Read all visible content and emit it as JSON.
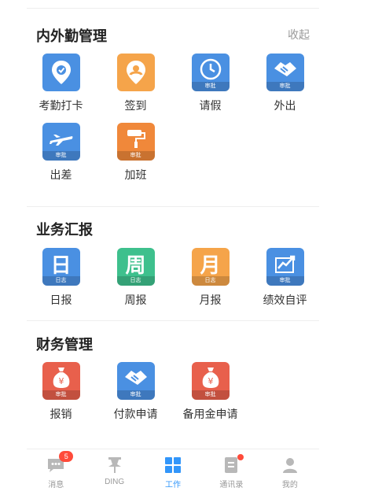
{
  "colors": {
    "blue": "#4a90e2",
    "orange": "#f5a44a",
    "green": "#3ec08d",
    "red": "#e8604c",
    "active_tab": "#3296fa"
  },
  "attendance": {
    "title": "内外勤管理",
    "collapse_label": "收起",
    "items": [
      {
        "label": "考勤打卡",
        "icon": "location-pin-icon"
      },
      {
        "label": "签到",
        "icon": "checkin-pin-icon"
      },
      {
        "label": "请假",
        "icon": "clock-icon",
        "band": "审批"
      },
      {
        "label": "外出",
        "icon": "handshake-icon",
        "band": "审批"
      },
      {
        "label": "出差",
        "icon": "airplane-icon",
        "band": "审批"
      },
      {
        "label": "加班",
        "icon": "paint-roller-icon",
        "band": "审批"
      }
    ]
  },
  "reports": {
    "title": "业务汇报",
    "items": [
      {
        "label": "日报",
        "char": "日",
        "band": "日志"
      },
      {
        "label": "周报",
        "char": "周",
        "band": "日志"
      },
      {
        "label": "月报",
        "char": "月",
        "band": "日志"
      },
      {
        "label": "绩效自评",
        "icon": "trend-chart-icon",
        "band": "审批"
      }
    ]
  },
  "finance": {
    "title": "财务管理",
    "items": [
      {
        "label": "报销",
        "icon": "money-bag-icon",
        "band": "审批"
      },
      {
        "label": "付款申请",
        "icon": "handshake-icon",
        "band": "审批"
      },
      {
        "label": "备用金申请",
        "icon": "money-bag-icon",
        "band": "审批"
      }
    ]
  },
  "tabbar": {
    "tabs": [
      {
        "label": "消息",
        "icon": "chat-bubble-icon",
        "badge": "5"
      },
      {
        "label": "DING",
        "icon": "pin-icon"
      },
      {
        "label": "工作",
        "icon": "grid-icon",
        "active": true
      },
      {
        "label": "通讯录",
        "icon": "contacts-book-icon",
        "dot": true
      },
      {
        "label": "我的",
        "icon": "person-icon"
      }
    ]
  }
}
